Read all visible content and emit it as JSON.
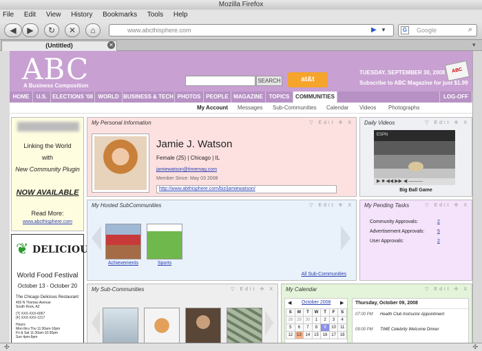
{
  "browser": {
    "title": "Mozilla Firefox",
    "menu": [
      "File",
      "Edit",
      "View",
      "History",
      "Bookmarks",
      "Tools",
      "Help"
    ],
    "url": "www.abcthisphere.com",
    "search_placeholder": "Google",
    "tab_title": "(Untitled)"
  },
  "site": {
    "logo": "ABC",
    "logo_sub": "A Business Composition",
    "search_button": "SEARCH",
    "sponsor": "at&t",
    "date": "TUESDAY, SEPTEMBER 30, 2008",
    "subscribe": "Subscribe to ABC Magazine for just $1.99",
    "mag_label": "ABC"
  },
  "topnav": [
    "HOME",
    "U.S.",
    "ELECTIONS '08",
    "WORLD",
    "BUSINESS & TECH",
    "PHOTOS",
    "PEOPLE",
    "MAGAZINE",
    "TOPICS",
    "COMMUNITIES"
  ],
  "logoff": "LOG-OFF",
  "subnav": [
    "My Account",
    "Messages",
    "Sub-Communities",
    "Calendar",
    "Videos",
    "Photographs"
  ],
  "promo": {
    "line1": "Linking the World",
    "line2": "with",
    "line3": "New Community Plugin",
    "now": "NOW AVAILABLE",
    "read": "Read More:",
    "link": "www.abcthisphere.com"
  },
  "ad": {
    "brand": "DELICIOUS",
    "event": "World Food Festival",
    "dates": "October 13 - October 20",
    "venue": "The Chicago Delicious Restaurant",
    "addr1": "403 N Thomas Avenue",
    "addr2": "South Rock, AZ",
    "phone": "(T) XXX-XXX-6067",
    "fax": "(F) XXX-XXX-1217",
    "hours_label": "Hours:",
    "hours1": "Mon thru Thu 11:30am-10pm",
    "hours2": "Fri & Sat 11:30am-10:30pm",
    "hours3": "Sun 4pm-9pm"
  },
  "panel_controls": "▽ Edit ✣ X",
  "profile": {
    "title": "My Personal Information",
    "name": "Jamie J. Watson",
    "info": "Female (25) | Chicago | IL",
    "email": "jamiewatson@timemag.com",
    "since": "Member Since: May 03 2008",
    "url": "http://www.abthisphere.com/biz/jamiewatson/"
  },
  "videos": {
    "title": "Daily Videos",
    "caption": "Big Ball Game",
    "watermark": "ESPN"
  },
  "hosted": {
    "title": "My Hosted SubCommunities",
    "items": [
      "Achievements",
      "Sports"
    ],
    "all": "All Sub-Communities"
  },
  "pending": {
    "title": "My Pending Tasks",
    "rows": [
      {
        "label": "Community Approvals:",
        "count": "2"
      },
      {
        "label": "Advertisement Approvals:",
        "count": "5"
      },
      {
        "label": "User Approvals:",
        "count": "2"
      }
    ]
  },
  "subs": {
    "title": "My Sub-Communities"
  },
  "calendar": {
    "title": "My Calendar",
    "month": "October 2008",
    "days": [
      "S",
      "M",
      "T",
      "W",
      "T",
      "F",
      "S"
    ],
    "weeks": [
      [
        "28",
        "29",
        "30",
        "1",
        "2",
        "3",
        "4"
      ],
      [
        "5",
        "6",
        "7",
        "8",
        "9",
        "10",
        "11"
      ],
      [
        "12",
        "13",
        "14",
        "15",
        "16",
        "17",
        "18"
      ]
    ],
    "today": "Thursday, October 09, 2008",
    "events": [
      {
        "time": "07:00 PM",
        "text": "Health Club Instructor Appointment"
      },
      {
        "time": "09:00 PM",
        "text": "TIME Celebrity Welcome Dinner"
      }
    ]
  }
}
